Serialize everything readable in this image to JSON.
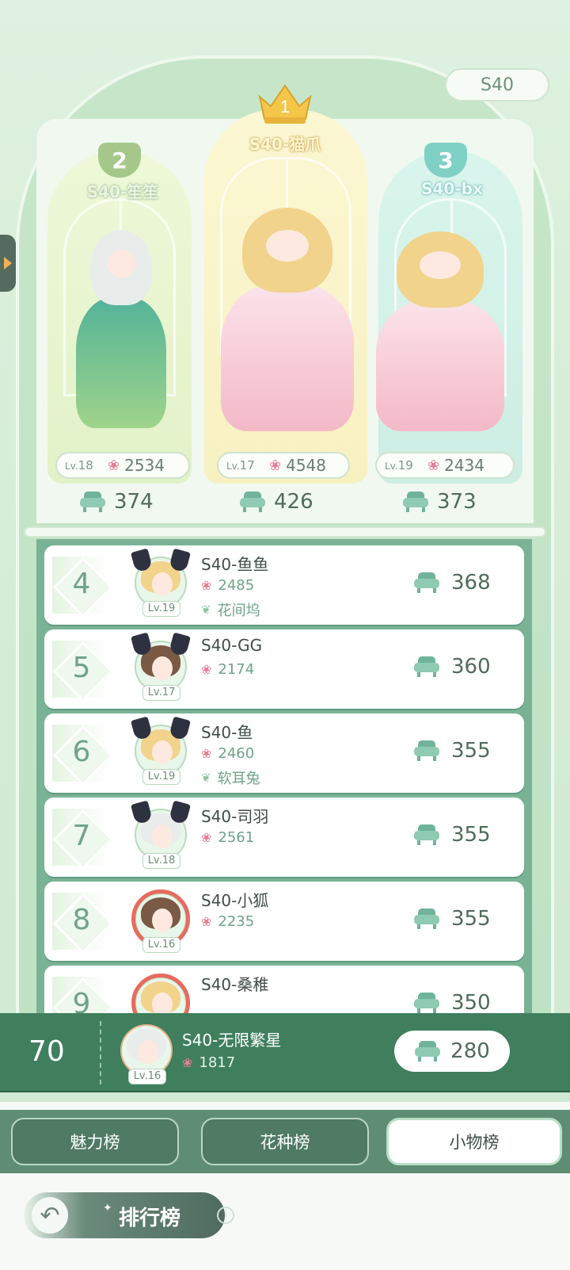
{
  "season_badge": "S40",
  "podium": [
    {
      "rank": "1",
      "name": "S40-猫爪",
      "level_prefix": "Lv.",
      "level": "17",
      "flowers": "4548",
      "score": "426"
    },
    {
      "rank": "2",
      "name": "S40-笙笙",
      "level_prefix": "Lv.",
      "level": "18",
      "flowers": "2534",
      "score": "374"
    },
    {
      "rank": "3",
      "name": "S40-bx",
      "level_prefix": "Lv.",
      "level": "19",
      "flowers": "2434",
      "score": "373"
    }
  ],
  "list": [
    {
      "rank": "4",
      "name": "S40-鱼鱼",
      "level": "Lv.19",
      "flowers": "2485",
      "guild": "花间坞",
      "score": "368",
      "frame": "cat"
    },
    {
      "rank": "5",
      "name": "S40-GG",
      "level": "Lv.17",
      "flowers": "2174",
      "guild": "",
      "score": "360",
      "frame": "cat"
    },
    {
      "rank": "6",
      "name": "S40-鱼",
      "level": "Lv.19",
      "flowers": "2460",
      "guild": "软耳兔",
      "score": "355",
      "frame": "cat"
    },
    {
      "rank": "7",
      "name": "S40-司羽",
      "level": "Lv.18",
      "flowers": "2561",
      "guild": "",
      "score": "355",
      "frame": "cat"
    },
    {
      "rank": "8",
      "name": "S40-小狐",
      "level": "Lv.16",
      "flowers": "2235",
      "guild": "",
      "score": "355",
      "frame": "berry"
    },
    {
      "rank": "9",
      "name": "S40-桑稚",
      "level": "",
      "flowers": "",
      "guild": "",
      "score": "350",
      "frame": "berry"
    }
  ],
  "self": {
    "rank": "70",
    "name": "S40-无限繁星",
    "level": "Lv.16",
    "flowers": "1817",
    "score": "280"
  },
  "tabs": [
    {
      "label": "魅力榜",
      "active": false
    },
    {
      "label": "花种榜",
      "active": false
    },
    {
      "label": "小物榜",
      "active": true
    }
  ],
  "footer": {
    "title": "排行榜",
    "info_symbol": "i"
  },
  "icons": {
    "flower": "flower-icon",
    "chair": "chair-icon",
    "guild": "guild-icon",
    "back": "back-arrow-icon",
    "crown": "crown-icon"
  },
  "colors": {
    "primary_green": "#3f7f5d",
    "accent_pink": "#e67f95",
    "light_green": "#d7eed8"
  }
}
